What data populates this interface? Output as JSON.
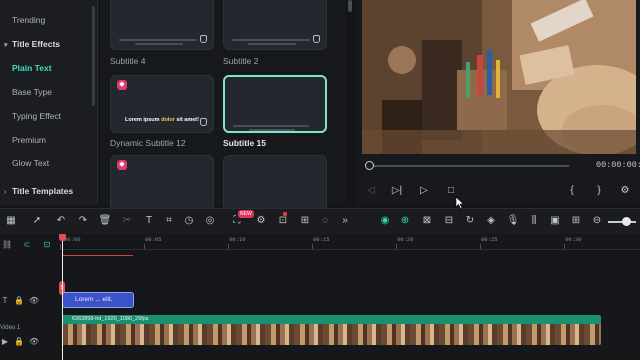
{
  "sidebar": {
    "items": [
      {
        "label": "Trending",
        "kind": "item"
      },
      {
        "label": "Title Effects",
        "kind": "group"
      },
      {
        "label": "Plain Text",
        "kind": "active"
      },
      {
        "label": "Base Type",
        "kind": "item"
      },
      {
        "label": "Typing Effect",
        "kind": "item"
      },
      {
        "label": "Premium",
        "kind": "item"
      },
      {
        "label": "Glow Text",
        "kind": "item"
      },
      {
        "label": "Title Templates",
        "kind": "group"
      }
    ]
  },
  "templates": {
    "tiles": [
      {
        "title": "Subtitle 4"
      },
      {
        "title": "Subtitle 2"
      },
      {
        "title": "Dynamic Subtitle 12",
        "text_pre": "Lorem ipsum ",
        "text_hl": "dolor",
        "text_post": " sit amet!"
      },
      {
        "title": "Subtitle 15"
      },
      {
        "title": ""
      },
      {
        "title": ""
      }
    ]
  },
  "preview": {
    "timecode": "00:00:00:00",
    "progress": 0.0
  },
  "toolbar": {
    "ai_badge": "NEW"
  },
  "timeline": {
    "ruler": [
      "00:00",
      "00:05",
      "00:10",
      "00:15",
      "00:20",
      "00:25",
      "00:30"
    ],
    "title_clip": "Lorem ... elit.",
    "video_clip": "6363898-hd_1920_1080_25fps",
    "track_video_label": "Video 1"
  },
  "colors": {
    "accent": "#3ee0b8",
    "clip_green": "#1a8f72",
    "clip_blue": "#3c52c8",
    "playhead_red": "#e05050"
  }
}
